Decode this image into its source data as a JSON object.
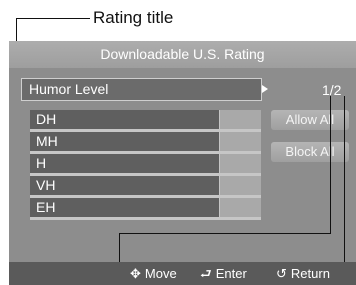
{
  "callout": {
    "label": "Rating title"
  },
  "window": {
    "title": "Downloadable U.S. Rating",
    "rating_title": "Humor Level",
    "page_indicator": "1/2"
  },
  "rows": [
    {
      "label": "DH"
    },
    {
      "label": "MH"
    },
    {
      "label": "H"
    },
    {
      "label": "VH"
    },
    {
      "label": "EH"
    }
  ],
  "buttons": {
    "allow_all": "Allow All",
    "block_all": "Block All"
  },
  "status_bar": {
    "move": "Move",
    "enter": "Enter",
    "return": "Return"
  },
  "colors": {
    "window_bg": "#8d8d8d",
    "title_bar": "#adadad",
    "row_bg": "#5f5f5f",
    "status_bg": "#5a5a5a"
  },
  "icons": {
    "move": "four-way-arrow-icon",
    "enter": "enter-icon",
    "return": "return-icon"
  }
}
